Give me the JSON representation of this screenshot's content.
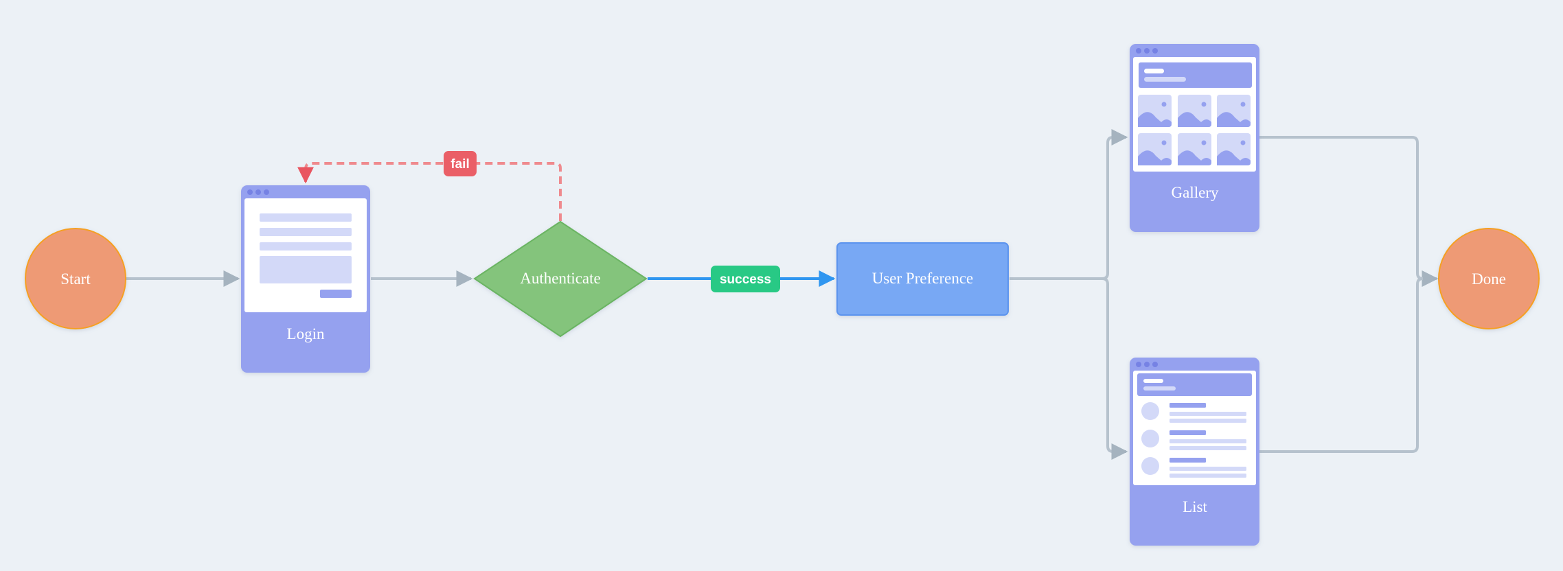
{
  "diagram": {
    "type": "flowchart",
    "colors": {
      "background": "#ecf1f6",
      "terminal_fill": "#ee9a74",
      "terminal_stroke": "#f5a020",
      "decision_fill": "#84c47c",
      "decision_stroke": "#6ab462",
      "process_fill": "#78a8f4",
      "process_stroke": "#5c94ee",
      "screen_frame": "#95a1ef",
      "screen_dot": "#7682e4",
      "screen_placeholder": "#d3d9f8",
      "connector": "#b6c2cd",
      "arrowhead": "#a5b3bf",
      "success_edge": "#2f96f0",
      "success_badge": "#28c985",
      "fail_edge": "#ef8a8e",
      "fail_badge": "#ea5f67",
      "fail_arrowhead": "#e95560"
    },
    "nodes": {
      "start": {
        "label": "Start",
        "shape": "circle"
      },
      "login": {
        "label": "Login",
        "shape": "screen-form"
      },
      "authenticate": {
        "label": "Authenticate",
        "shape": "diamond"
      },
      "user_preference": {
        "label": "User Preference",
        "shape": "rectangle"
      },
      "gallery": {
        "label": "Gallery",
        "shape": "screen-gallery"
      },
      "list": {
        "label": "List",
        "shape": "screen-list"
      },
      "done": {
        "label": "Done",
        "shape": "circle"
      }
    },
    "edges": [
      {
        "from": "Start",
        "to": "Login",
        "label": ""
      },
      {
        "from": "Login",
        "to": "Authenticate",
        "label": ""
      },
      {
        "from": "Authenticate",
        "to": "Login",
        "label": "fail",
        "style": "dashed"
      },
      {
        "from": "Authenticate",
        "to": "User Preference",
        "label": "success"
      },
      {
        "from": "User Preference",
        "to": "Gallery",
        "label": ""
      },
      {
        "from": "User Preference",
        "to": "List",
        "label": ""
      },
      {
        "from": "Gallery",
        "to": "Done",
        "label": ""
      },
      {
        "from": "List",
        "to": "Done",
        "label": ""
      }
    ],
    "edge_labels": {
      "fail": "fail",
      "success": "success"
    }
  }
}
